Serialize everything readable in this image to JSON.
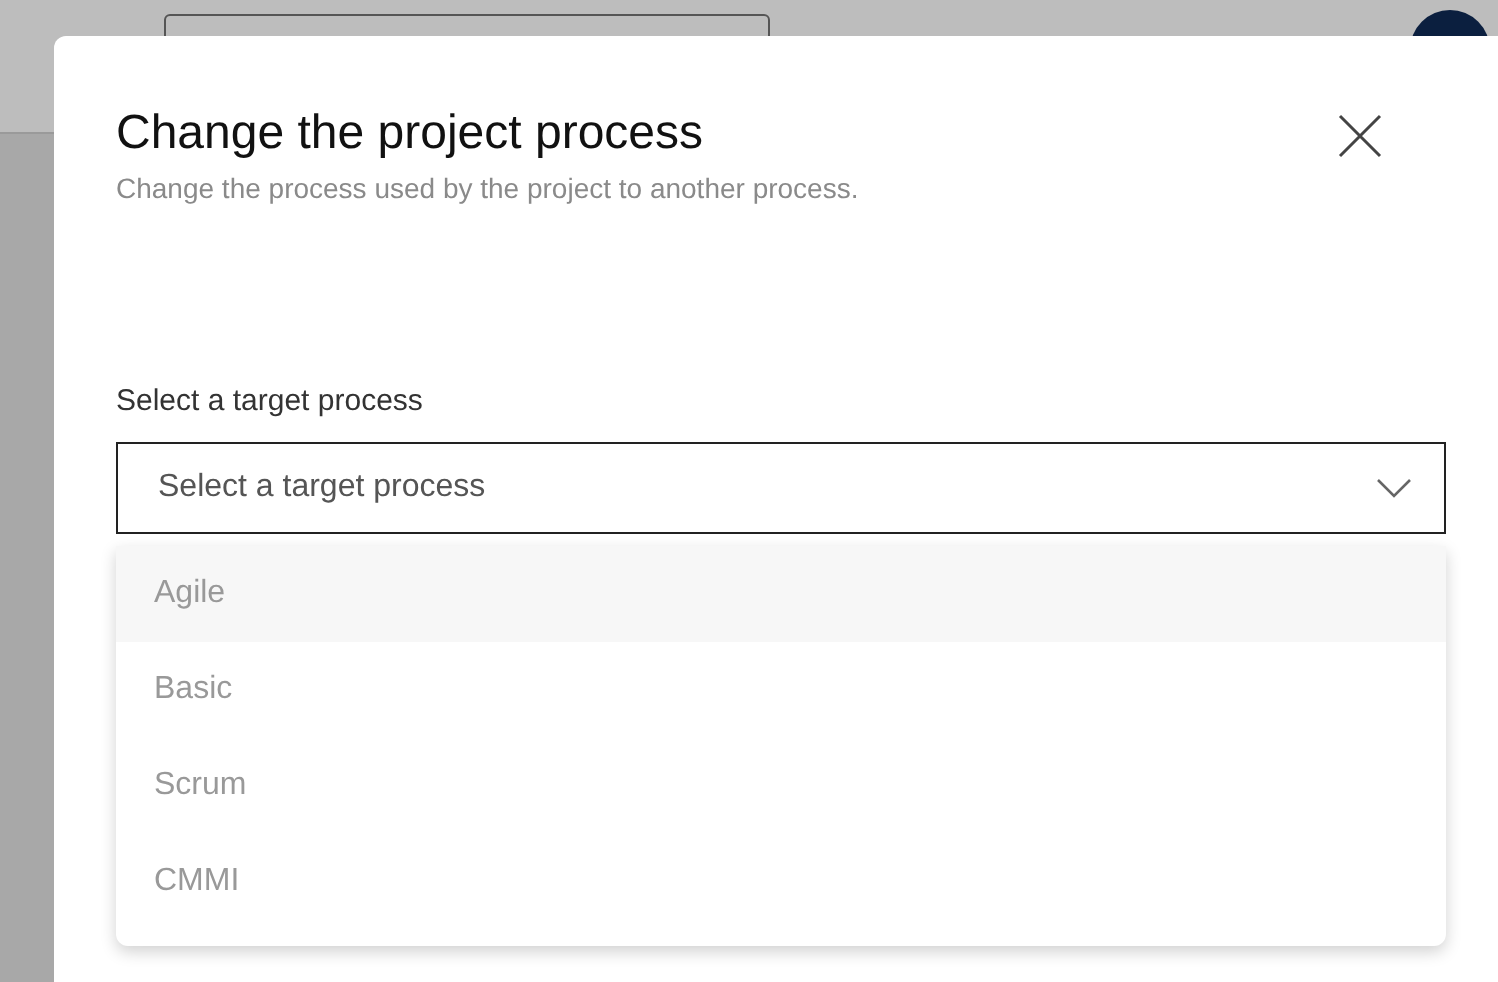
{
  "dialog": {
    "title": "Change the project process",
    "subtitle": "Change the process used by the project to another process.",
    "field": {
      "label": "Select a target process",
      "placeholder": "Select a target process",
      "expanded": true
    },
    "options": [
      {
        "label": "Agile",
        "selected": true
      },
      {
        "label": "Basic",
        "selected": false
      },
      {
        "label": "Scrum",
        "selected": false
      },
      {
        "label": "CMMI",
        "selected": false
      }
    ]
  }
}
